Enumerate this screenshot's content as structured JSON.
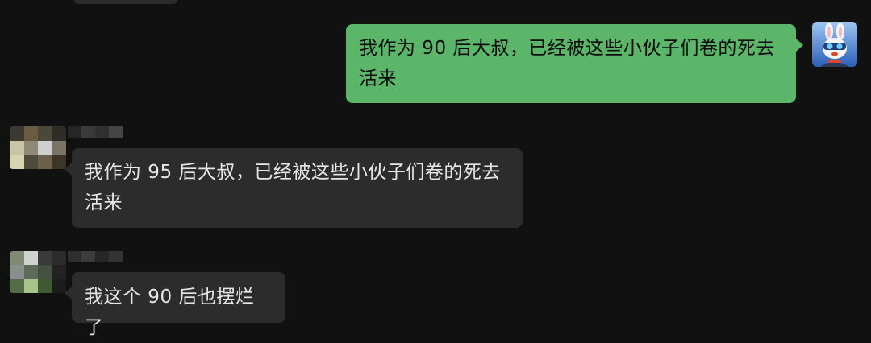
{
  "messages": [
    {
      "id": "m1",
      "direction": "sent",
      "text": "我作为 90 后大叔，已经被这些小伙子们卷的死去活来"
    },
    {
      "id": "m2",
      "direction": "received",
      "sender_name": "",
      "text": "我作为 95 后大叔，已经被这些小伙子们卷的死去活来"
    },
    {
      "id": "m3",
      "direction": "received",
      "sender_name": "",
      "text": "我这个 90 后也摆烂了"
    }
  ],
  "self_avatar": {
    "icon": "rabbit-avatar-icon",
    "colors": {
      "bg": "#2a5fb8",
      "fur": "#f2f4f8",
      "accent": "#e2452e"
    }
  },
  "colors": {
    "background": "#111111",
    "sent_bubble": "#5bb669",
    "received_bubble": "#2c2c2c",
    "sent_text": "#0b0b0b",
    "received_text": "#e6e6e6"
  }
}
